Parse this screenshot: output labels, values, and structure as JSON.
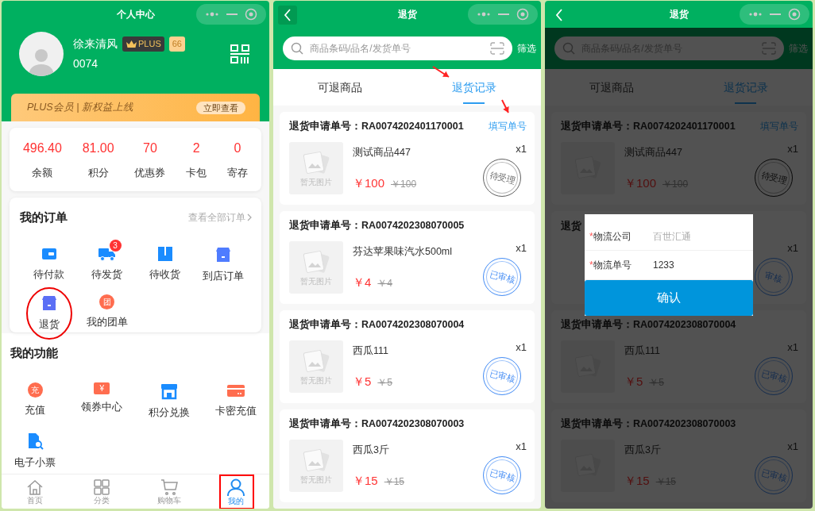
{
  "profile_screen": {
    "title": "个人中心",
    "user": {
      "name": "徐来清风",
      "member_tier": "PLUS",
      "level": "66",
      "id": "0074"
    },
    "banner": {
      "text": "PLUS会员 | 新权益上线",
      "button": "立即查看"
    },
    "stats": [
      {
        "value": "496.40",
        "label": "余额"
      },
      {
        "value": "81.00",
        "label": "积分"
      },
      {
        "value": "70",
        "label": "优惠券"
      },
      {
        "value": "2",
        "label": "卡包"
      },
      {
        "value": "0",
        "label": "寄存"
      }
    ],
    "orders": {
      "title": "我的订单",
      "link": "查看全部订单",
      "items": [
        {
          "label": "待付款",
          "kind": "wallet",
          "annotated": false
        },
        {
          "label": "待发货",
          "kind": "truck",
          "badge": "3",
          "annotated": false
        },
        {
          "label": "待收货",
          "kind": "box",
          "annotated": false
        },
        {
          "label": "到店订单",
          "kind": "shop",
          "annotated": false
        },
        {
          "label": "退货",
          "kind": "return",
          "annotated": true
        },
        {
          "label": "我的团单",
          "kind": "glyph",
          "glyph": "团",
          "annotated": false
        }
      ]
    },
    "functions": {
      "title": "我的功能",
      "items": [
        {
          "label": "充值",
          "kind": "glyph",
          "glyph": "充"
        },
        {
          "label": "领券中心",
          "kind": "coupon",
          "glyph": "¥"
        },
        {
          "label": "积分兑换",
          "kind": "store"
        },
        {
          "label": "卡密充值",
          "kind": "card"
        },
        {
          "label": "电子小票",
          "kind": "receipt"
        }
      ]
    },
    "bottom_nav": [
      {
        "label": "首页",
        "kind": "home",
        "selected": false,
        "annotated": false
      },
      {
        "label": "分类",
        "kind": "grid",
        "selected": false,
        "annotated": false
      },
      {
        "label": "购物车",
        "kind": "cart",
        "selected": false,
        "annotated": false
      },
      {
        "label": "我的",
        "kind": "person",
        "selected": true,
        "annotated": true
      }
    ]
  },
  "returns_screen": {
    "title": "退货",
    "back_pressed": true,
    "search": {
      "placeholder": "商品条码/品名/发货单号"
    },
    "filter": "筛选",
    "tabs": [
      {
        "label": "可退商品",
        "selected": false,
        "pointed": false
      },
      {
        "label": "退货记录",
        "selected": true,
        "pointed": true
      }
    ],
    "records": [
      {
        "kind": "full",
        "order": "退货申请单号：RA0074202401170001",
        "action": "填写单号",
        "action_pointed": true,
        "image_caption": "暂无图片",
        "name": "测试商品447",
        "price": "￥100",
        "original_price": "￥100",
        "quantity": "x1",
        "stamp": {
          "text": "待受理",
          "kind": "pending"
        }
      },
      {
        "kind": "full",
        "order": "退货申请单号：RA0074202308070005",
        "image_caption": "暂无图片",
        "name": "芬达苹果味汽水500ml",
        "price": "￥4",
        "original_price": "￥4",
        "quantity": "x1",
        "stamp": {
          "text": "已审核",
          "kind": "approved"
        }
      },
      {
        "kind": "full",
        "order": "退货申请单号：RA0074202308070004",
        "image_caption": "暂无图片",
        "name": "西瓜111",
        "price": "￥5",
        "original_price": "￥5",
        "quantity": "x1",
        "stamp": {
          "text": "已审核",
          "kind": "approved"
        }
      },
      {
        "kind": "full",
        "order": "退货申请单号：RA0074202308070003",
        "image_caption": "暂无图片",
        "name": "西瓜3斤",
        "price": "￥15",
        "original_price": "￥15",
        "quantity": "x1",
        "stamp": {
          "text": "已审核",
          "kind": "approved"
        }
      }
    ]
  },
  "returns_dialog_screen": {
    "title": "退货",
    "back_pressed": false,
    "search": {
      "placeholder": "商品条码/品名/发货单号"
    },
    "filter": "筛选",
    "tabs": [
      {
        "label": "可退商品",
        "selected": false,
        "pointed": false
      },
      {
        "label": "退货记录",
        "selected": true,
        "pointed": false
      }
    ],
    "records": [
      {
        "kind": "full",
        "order": "退货申请单号：RA0074202401170001",
        "action": "填写单号",
        "action_pointed": false,
        "name": "测试商品447",
        "price": "￥100",
        "original_price": "￥100",
        "quantity": "x1",
        "stamp": {
          "text": "待受理",
          "kind": "pending"
        }
      },
      {
        "kind": "partial",
        "order": "退货",
        "quantity": "x1",
        "stamp": {
          "text": "审核",
          "kind": "approved"
        }
      },
      {
        "kind": "full",
        "order": "退货申请单号：RA0074202308070004",
        "name": "西瓜111",
        "price": "￥5",
        "original_price": "￥5",
        "quantity": "x1",
        "stamp": {
          "text": "已审核",
          "kind": "approved"
        }
      },
      {
        "kind": "full",
        "order": "退货申请单号：RA0074202308070003",
        "name": "西瓜3斤",
        "price": "￥15",
        "original_price": "￥15",
        "quantity": "x1",
        "stamp": {
          "text": "已审核",
          "kind": "approved"
        }
      }
    ],
    "dialog": {
      "fields": [
        {
          "mark": "*",
          "label": "物流公司",
          "value": "百世汇通",
          "kind": "select"
        },
        {
          "mark": "*",
          "label": "物流单号",
          "value": "1233",
          "kind": "text"
        }
      ],
      "button": "确认"
    }
  }
}
